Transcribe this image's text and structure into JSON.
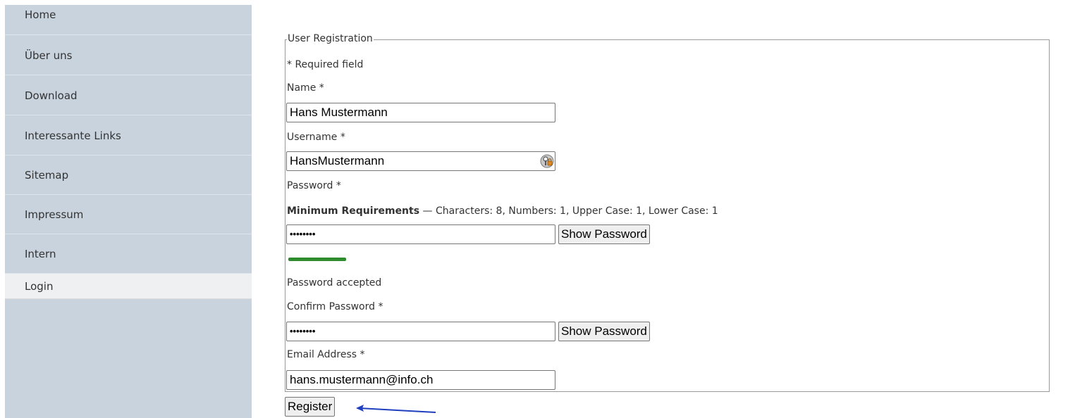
{
  "sidebar": {
    "items": [
      {
        "label": "Home"
      },
      {
        "label": "Über uns"
      },
      {
        "label": "Download"
      },
      {
        "label": "Interessante Links"
      },
      {
        "label": "Sitemap"
      },
      {
        "label": "Impressum"
      },
      {
        "label": "Intern"
      },
      {
        "label": "Login",
        "active": true
      }
    ]
  },
  "form": {
    "legend": "User Registration",
    "required_note": "* Required field",
    "name": {
      "label": "Name *",
      "value": "Hans Mustermann"
    },
    "username": {
      "label": "Username *",
      "value": "HansMustermann"
    },
    "password": {
      "label": "Password *",
      "requirements_bold": "Minimum Requirements",
      "requirements_text": " — Characters: 8, Numbers: 1, Upper Case: 1, Lower Case: 1",
      "value_masked": "••••••••",
      "show_label": "Show Password",
      "status": "Password accepted"
    },
    "confirm_password": {
      "label": "Confirm Password *",
      "value_masked": "••••••••",
      "show_label": "Show Password"
    },
    "email": {
      "label": "Email Address *",
      "value": "hans.mustermann@info.ch"
    },
    "register_label": "Register"
  },
  "colors": {
    "sidebar_bg": "#c9d3de",
    "active_item_bg": "#eef0f2",
    "strength_bar": "#2e8b2e",
    "arrow": "#1f3fbf"
  },
  "icons": {
    "username_field": "password-manager-key-icon",
    "pointer": "arrow-pointer-icon"
  }
}
